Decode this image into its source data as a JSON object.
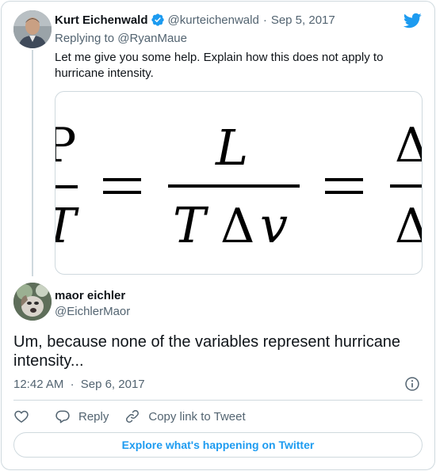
{
  "quoted_tweet": {
    "author_name": "Kurt Eichenwald",
    "handle": "@kurteichenwald",
    "date": "Sep 5, 2017",
    "separator": "·",
    "replying_prefix": "Replying to",
    "replying_to": "@RyanMaue",
    "text": "Let me give you some help. Explain how this does not apply to hurricane intensity.",
    "media_equation": {
      "numerator": "L",
      "denominator_t": "T",
      "denominator_delta": "Δ",
      "denominator_v": "v",
      "equals": "=",
      "right_delta": "Δ"
    }
  },
  "main_tweet": {
    "author_name": "maor eichler",
    "handle": "@EichlerMaor",
    "text": "Um, because none of the variables represent hurricane intensity...",
    "time": "12:42 AM",
    "separator": "·",
    "date": "Sep 6, 2017"
  },
  "actions": {
    "reply_label": "Reply",
    "copy_link_label": "Copy link to Tweet"
  },
  "explore_button": "Explore what's happening on Twitter",
  "colors": {
    "accent": "#1d9bf0",
    "muted": "#536471",
    "border": "#cfd9de",
    "text": "#0f1419"
  },
  "icons": [
    "verified-badge-icon",
    "twitter-bird-icon",
    "info-icon",
    "heart-icon",
    "reply-icon",
    "link-icon"
  ]
}
